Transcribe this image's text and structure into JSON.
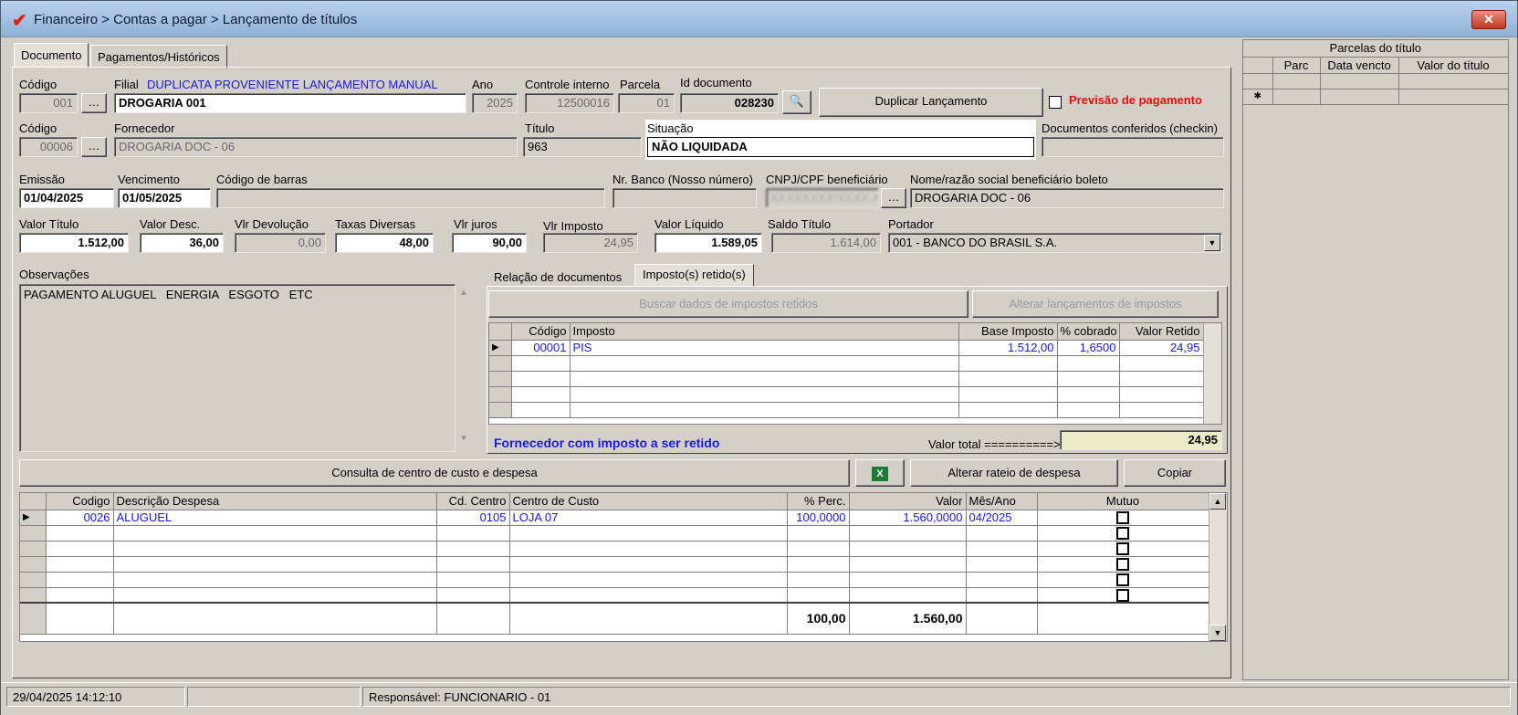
{
  "window": {
    "title": "Financeiro > Contas a pagar > Lançamento de títulos",
    "close": "✕"
  },
  "tabs": [
    "Documento",
    "Pagamentos/Históricos"
  ],
  "row1": {
    "codigo_label": "Código",
    "codigo": "001",
    "filial_label": "Filial",
    "filial_note": "DUPLICATA PROVENIENTE LANÇAMENTO MANUAL",
    "filial": "DROGARIA 001",
    "ano_label": "Ano",
    "ano": "2025",
    "controle_label": "Controle interno",
    "controle": "12500016",
    "parcela_label": "Parcela",
    "parcela": "01",
    "iddoc_label": "Id documento",
    "iddoc": "028230",
    "duplicar": "Duplicar Lançamento",
    "previsao": "Previsão de pagamento"
  },
  "row2": {
    "codigo_label": "Código",
    "codigo": "00006",
    "fornecedor_label": "Fornecedor",
    "fornecedor": "DROGARIA DOC - 06",
    "titulo_label": "Título",
    "titulo": "963",
    "situacao_label": "Situação",
    "situacao": "NÃO LIQUIDADA",
    "checkin_label": "Documentos conferidos (checkin)",
    "checkin": ""
  },
  "row3": {
    "emissao_label": "Emissão",
    "emissao": "01/04/2025",
    "venc_label": "Vencimento",
    "venc": "01/05/2025",
    "barras_label": "Código de barras",
    "barras": "",
    "nrbanco_label": "Nr. Banco (Nosso número)",
    "nrbanco": "",
    "cnpj_label": "CNPJ/CPF beneficiário",
    "cnpj": "XXXXXXXX/XXXX-XX",
    "nome_label": "Nome/razão social beneficiário boleto",
    "nome": "DROGARIA DOC - 06"
  },
  "row4": {
    "valor_titulo_label": "Valor Título",
    "valor_titulo": "1.512,00",
    "valor_desc_label": "Valor Desc.",
    "valor_desc": "36,00",
    "vlr_dev_label": "Vlr Devolução",
    "vlr_dev": "0,00",
    "taxas_label": "Taxas Diversas",
    "taxas": "48,00",
    "juros_label": "Vlr juros",
    "juros": "90,00",
    "imposto_label": "Vlr Imposto",
    "imposto": "24,95",
    "liquido_label": "Valor Líquido",
    "liquido": "1.589,05",
    "saldo_label": "Saldo Título",
    "saldo": "1.614,00",
    "portador_label": "Portador",
    "portador": "001 - BANCO DO BRASIL S.A."
  },
  "obs": {
    "label": "Observações",
    "text": "PAGAMENTO ALUGUEL   ENERGIA   ESGOTO   ETC"
  },
  "docs": {
    "tab_rel": "Relação de documentos",
    "tab_imp": "Imposto(s) retido(s)",
    "btn_buscar": "Buscar dados de impostos retidos",
    "btn_alterar": "Alterar lançamentos de impostos",
    "headers": [
      "Código",
      "Imposto",
      "Base Imposto",
      "% cobrado",
      "Valor Retido"
    ],
    "rows": [
      [
        "00001",
        "PIS",
        "1.512,00",
        "1,6500",
        "24,95"
      ]
    ],
    "warning": "Fornecedor com imposto a ser retido",
    "total_label": "Valor total ==========>",
    "total": "24,95"
  },
  "toolbar": {
    "consulta": "Consulta de centro de custo e despesa",
    "excel": "X",
    "rateio": "Alterar rateio de despesa",
    "copiar": "Copiar"
  },
  "despesas": {
    "headers": [
      "Codigo",
      "Descrição Despesa",
      "Cd. Centro",
      "Centro de Custo",
      "% Perc.",
      "Valor",
      "Mês/Ano",
      "Mutuo"
    ],
    "rows": [
      [
        "0026",
        "ALUGUEL",
        "0105",
        "LOJA 07",
        "100,0000",
        "1.560,0000",
        "04/2025"
      ]
    ],
    "tot_perc": "100,00",
    "tot_valor": "1.560,00"
  },
  "parcelas": {
    "title": "Parcelas do título",
    "headers": [
      "Parc",
      "Data vencto",
      "Valor do título"
    ]
  },
  "status": {
    "datetime": "29/04/2025 14:12:10",
    "middle": "",
    "responsavel": "Responsável: FUNCIONARIO - 01"
  }
}
